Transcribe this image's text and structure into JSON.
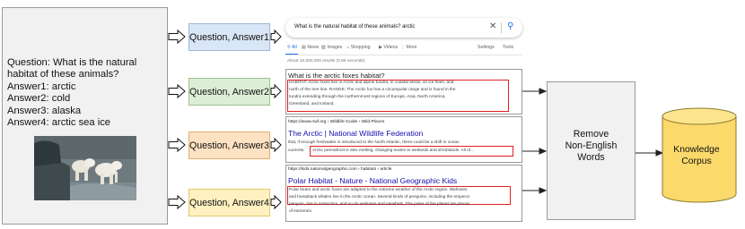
{
  "question_panel": {
    "lines": [
      "Question: What is the natural",
      "habitat of these animals?",
      "Answer1:  arctic",
      "Answer2:  cold",
      "Answer3:  alaska",
      "Answer4:  arctic sea ice"
    ]
  },
  "qa_boxes": [
    "Question, Answer1",
    "Question, Answer2",
    "Question, Answer3",
    "Question, Answer4"
  ],
  "search": {
    "query": "What is the natural habitat of these animals? arctic",
    "clear_icon": "close-icon",
    "search_icon": "search-icon",
    "tabs": [
      "All",
      "News",
      "Images",
      "Shopping",
      "Videos",
      "More",
      "Settings",
      "Tools"
    ],
    "result_stats": "About 10,600,000 results (0.66 seconds)"
  },
  "featured": {
    "title": "What is the arctic foxes habitat?",
    "lines": [
      "HABITAT: Arctic foxes live in Arctic and alpine tundra, in coastal areas, on ice floes, and",
      "north of the tree line. RANGE: The Arctic fox has a circumpolar range and is found in the",
      "tundra extending through the northernmost regions of Europe, Asia, North America,",
      "Greenland, and Iceland."
    ]
  },
  "result2": {
    "url": "https://www.nwf.org › Wildlife-Guide › Wild-Places",
    "title": "The Arctic | National Wildlife Federation",
    "line1": "that, if enough freshwater is introduced to the North Atlantic, there could be a shift in ocean",
    "line2_prefix": "currents.",
    "line2_highlight": "Arctic permafrost is also melting, changing tussks to wetlands and shrublands. All of..."
  },
  "result3": {
    "url": "https://kids.nationalgeographic.com › habitats › article",
    "title": "Polar Habitat - Nature - National Geographic Kids",
    "lines": [
      "Polar bears and arctic foxes are adapted to the extreme weather of the Arctic region. Walruses",
      "and humpback whales live in the Arctic ocean. Several kinds of penguins, including the emperor",
      "penguin, live in Antarctica, and so do walruses and narwhals. The poles of the planet are places",
      "of extremes."
    ]
  },
  "remove": {
    "lines": [
      "Remove",
      "Non-English",
      "Words"
    ]
  },
  "knowledge": {
    "lines": [
      "Knowledge",
      "Corpus"
    ]
  },
  "colors": {
    "qa1": "#d9e6f6",
    "qa2": "#dcefd6",
    "qa3": "#fce1c2",
    "qa4": "#fff1c0",
    "cylinder": "#fcd96b",
    "highlight": "#e02020",
    "link": "#1a0dab"
  }
}
